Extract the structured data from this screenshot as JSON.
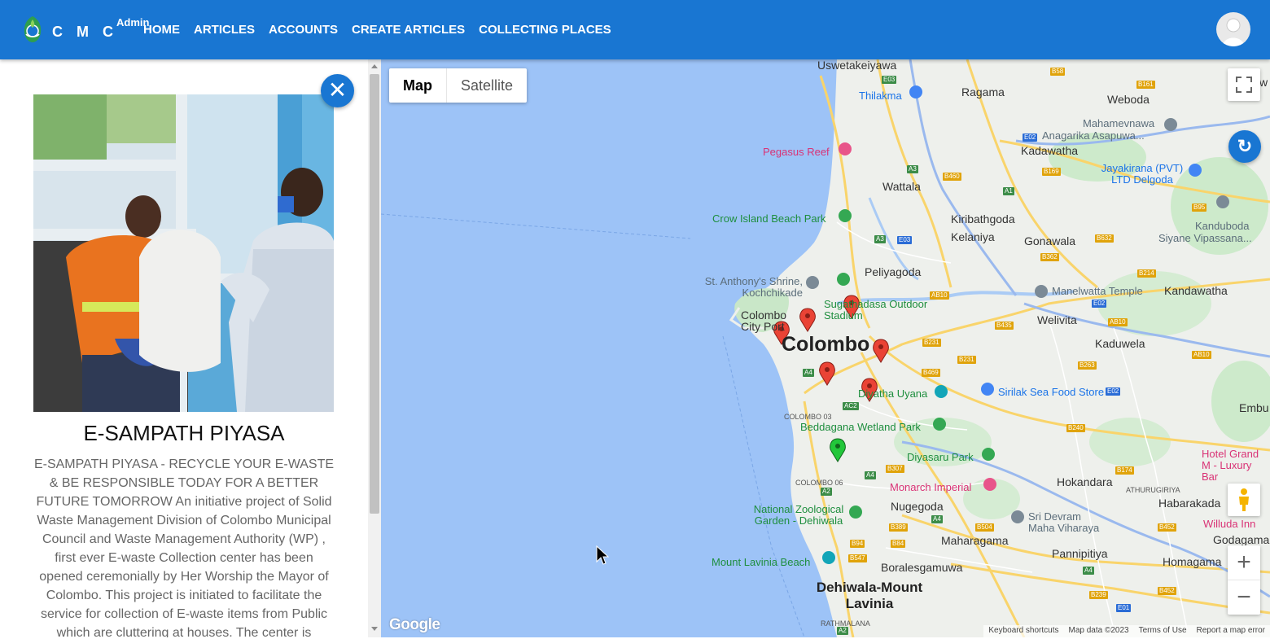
{
  "header": {
    "brand": "C M C",
    "brand_sup": "Admin",
    "nav": [
      "HOME",
      "ARTICLES",
      "ACCOUNTS",
      "CREATE ARTICLES",
      "COLLECTING PLACES"
    ]
  },
  "article": {
    "title": "E-SAMPATH PIYASA",
    "body": "E-SAMPATH PIYASA - RECYCLE YOUR E-WASTE & BE RESPONSIBLE TODAY FOR A BETTER FUTURE TOMORROW An initiative project of Solid Waste Management Division of Colombo Municipal Council and Waste Management Authority (WP) , first ever E-waste Collection center has been opened ceremonially by Her Worship the Mayor of Colombo. This project is initiated to facilitate the service for collection of E-waste items from Public which are cluttering at houses. The center is"
  },
  "map": {
    "map_type_options": [
      "Map",
      "Satellite"
    ],
    "selected_map_type": "Map",
    "google_logo": "Google",
    "attribution": [
      "Keyboard shortcuts",
      "Map data ©2023",
      "Terms of Use",
      "Report a map error"
    ],
    "labels": {
      "big": "Colombo",
      "dehiwala": "Dehiwala-Mount Lavinia",
      "places": [
        "Uswetakeiyawa",
        "Ragama",
        "Weliw",
        "Weboda",
        "Thilakma",
        "Mahamevnawa",
        "Anagarika Asapuwa...",
        "Kadawatha",
        "Pegasus Reef",
        "Jayakirana (PVT) LTD Delgoda",
        "Wattala",
        "Crow Island Beach Park",
        "Kiribathgoda",
        "Kelaniya",
        "Gonawala",
        "Kanduboda",
        "Siyane Vipassana...",
        "Peliyagoda",
        "St. Anthony's Shrine, Kochchikade",
        "Sugathadasa Outdoor Stadium",
        "Colombo City Port",
        "Manelwatta Temple",
        "Kandawatha",
        "Welivita",
        "Kaduwela",
        "Diyatha Uyana",
        "Sirilak Sea Food Store",
        "Embu",
        "Beddagana Wetland Park",
        "Diyasaru Park",
        "Hotel Grand M - Luxury Bar",
        "Monarch Imperial",
        "Hokandara",
        "ATHURUGIRIYA",
        "Nugegoda",
        "National Zoological Garden - Dehiwala",
        "Sri Devram Maha Viharaya",
        "Habarakada",
        "Willuda Inn",
        "Godagama",
        "Maharagama",
        "Pannipitiya",
        "Mount Lavinia Beach",
        "Homagama",
        "Boralesgamuwa",
        "RATHMALANA",
        "COLOMBO 03",
        "COLOMBO 06"
      ]
    },
    "roads": [
      "E03",
      "B58",
      "B161",
      "E02",
      "B169",
      "A3",
      "B460",
      "A1",
      "B95",
      "E03",
      "A3",
      "B632",
      "B362",
      "B214",
      "AB10",
      "E02",
      "B435",
      "AB10",
      "B231",
      "B231",
      "B469",
      "A4",
      "AC2",
      "B263",
      "AB10",
      "E02",
      "B240",
      "B307",
      "A4",
      "B174",
      "A2",
      "B389",
      "A4",
      "B504",
      "B452",
      "B94",
      "B84",
      "B547",
      "A4",
      "B452",
      "B239",
      "E01",
      "A2"
    ],
    "markers": {
      "red": 6,
      "green": 1
    }
  }
}
